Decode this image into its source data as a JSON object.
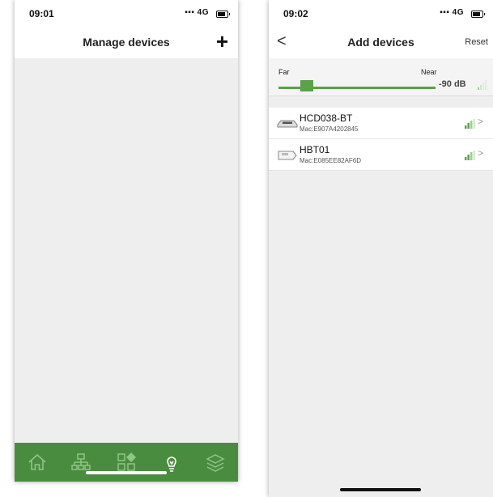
{
  "left_screen": {
    "status": {
      "time": "09:01",
      "network": "4G"
    },
    "nav": {
      "title": "Manage devices",
      "add_icon": "plus-icon"
    },
    "tabs": [
      {
        "icon": "home-icon"
      },
      {
        "icon": "network-icon"
      },
      {
        "icon": "apps-icon"
      },
      {
        "icon": "bulb-icon"
      },
      {
        "icon": "layers-icon"
      }
    ]
  },
  "right_screen": {
    "status": {
      "time": "09:02",
      "network": "4G"
    },
    "nav": {
      "back": "<",
      "title": "Add devices",
      "reset": "Reset"
    },
    "slider": {
      "far_label": "Far",
      "near_label": "Near",
      "value_db": "-90 dB",
      "level": 0.14
    },
    "devices": [
      {
        "name": "HCD038-BT",
        "mac": "Mac:E907A4202845",
        "icon": "printer-icon"
      },
      {
        "name": "HBT01",
        "mac": "Mac:E085EE82AF6D",
        "icon": "scale-icon"
      }
    ]
  },
  "colors": {
    "accent": "#5aa14a",
    "tabbar": "#4a8c3f",
    "background": "#eeeeee"
  }
}
